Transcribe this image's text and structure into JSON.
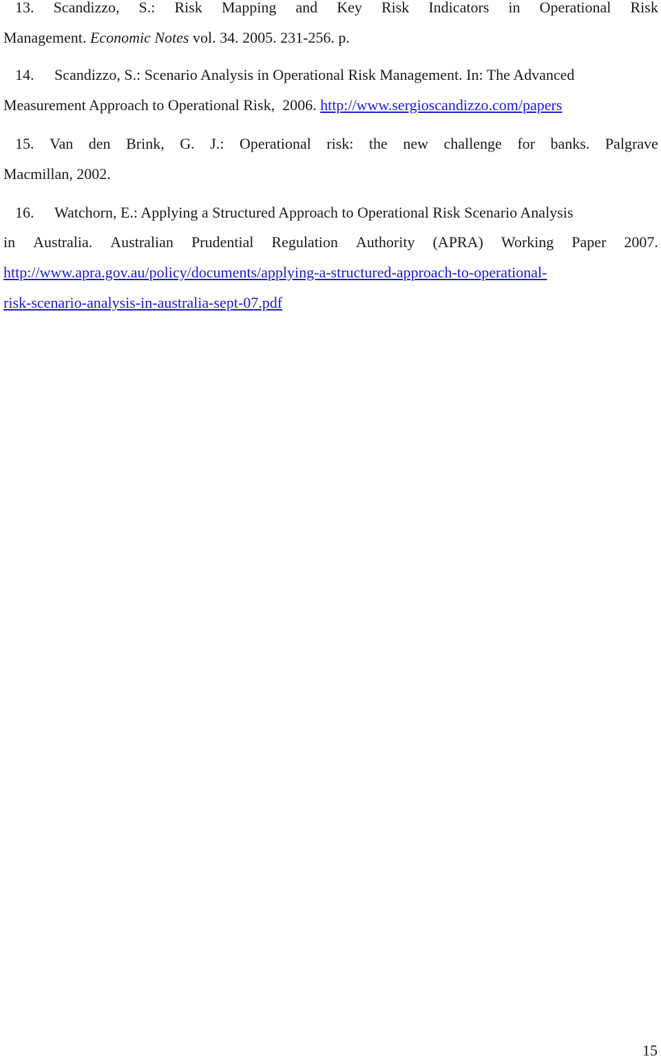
{
  "references": [
    {
      "number": "13.",
      "line1_words": [
        "Scandizzo,",
        "S.:",
        "Risk",
        "Mapping",
        "and",
        "Key",
        "Risk",
        "Indicators",
        "in",
        "Operational",
        "Risk"
      ],
      "line2_prefix": "Management.",
      "journal": "Economic Notes",
      "line2_suffix": " vol. 34. 2005. 231-256. p."
    },
    {
      "number": "14.",
      "line1": "Scandizzo, S.: Scenario Analysis in Operational Risk Management. In: The Advanced",
      "line2_prefix": "Measurement Approach to Operational Risk,  2006. ",
      "link": "http://www.sergioscandizzo.com/papers"
    },
    {
      "number": "15.",
      "line1_words": [
        "Van",
        "den",
        "Brink,",
        "G.",
        "J.:",
        "Operational",
        "risk:",
        "the",
        "new",
        "challenge",
        "for",
        "banks.",
        "Palgrave"
      ],
      "line2": "Macmillan, 2002."
    },
    {
      "number": "16.",
      "line1": "Watchorn, E.: Applying a Structured Approach to Operational Risk Scenario Analysis",
      "line2_words": [
        "in",
        "Australia.",
        "Australian",
        "Prudential",
        "Regulation",
        "Authority",
        "(APRA)",
        "Working",
        "Paper",
        "2007."
      ],
      "link_line1": "http://www.apra.gov.au/policy/documents/applying-a-structured-approach-to-operational-",
      "link_line2": "risk-scenario-analysis-in-australia-sept-07.pdf"
    }
  ],
  "page_number": "15",
  "colors": {
    "text": "#1a1a1a",
    "link": "#1a1acc",
    "background": "#ffffff"
  }
}
